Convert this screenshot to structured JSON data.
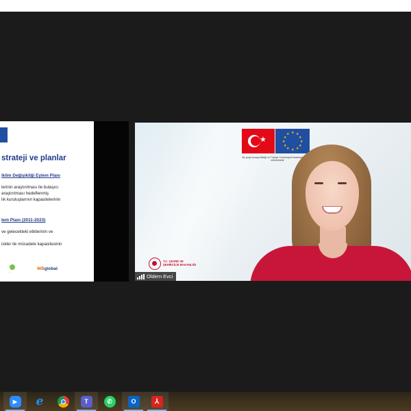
{
  "slide": {
    "eu_caption": "...",
    "title": "strateji ve planlar",
    "heading1": "iklim Değişikliği Eylem Planı",
    "line1": "lerinin araştırılması ile bulaşıcı",
    "line2": "araştırılması hedeflenmiş",
    "line3": "lık kuruluşlarının kapasitelerinin",
    "heading2": "lem Planı (2011-2023)",
    "line4": "ve gelecekteki etkilerinin ve",
    "line5": "iskler ile mücadele kapasitesinin",
    "logo_small_text": "...",
    "logo_wb_text": "WB",
    "logo_wb_suffix": "global"
  },
  "video": {
    "caption": "Bu proje Avrupa Birliği ve Türkiye Cumhuriyeti tarafından finanse edilmektedir",
    "ministry_line1": "T.C. ÇEVRE VE",
    "ministry_line2": "ŞEHİRCİLİK BAKANLIĞI",
    "participant_name": "Oldem Evci"
  },
  "taskbar": {
    "icons": [
      "zoom-icon",
      "internet-explorer-icon",
      "chrome-icon",
      "teams-icon",
      "whatsapp-icon",
      "outlook-icon",
      "acrobat-icon"
    ],
    "zoom_glyph": "▶",
    "ie_glyph": "e",
    "teams_glyph": "T",
    "whatsapp_glyph": "✆",
    "outlook_glyph": "O",
    "acrobat_glyph": "⅄"
  },
  "colors": {
    "accent_blue": "#1f3c88",
    "eu_blue": "#1f4ea3",
    "tr_red": "#e30a17",
    "shirt_red": "#c8163a"
  }
}
